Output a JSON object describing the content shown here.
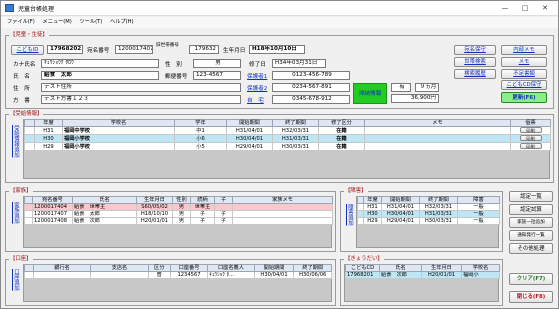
{
  "window": {
    "title": "児童台帳処理",
    "minimize": "—",
    "maximize": "□",
    "close": "✕"
  },
  "menu": [
    "ファイル(F)",
    "メニュー(M)",
    "ツール(T)",
    "ヘルプ(H)"
  ],
  "basic": {
    "section_title": "【児童・生徒】",
    "child_btn": "こどもID",
    "child_id": "17968202",
    "address_no_label": "宛名番号",
    "address_no": "1200017407",
    "guardian_label": "旧世帯番号",
    "guardian_no": "179632",
    "birth_label": "生年月日",
    "birth": "H18年10月10日",
    "kana_label": "カナ氏名",
    "kana": "ｷｭｳｼｮｳｸ ﾀﾛｳ",
    "sex_label": "性　別",
    "sex": "男",
    "grad_label": "修了日",
    "grad": "H34年03月31日",
    "name_label": "氏　名",
    "name": "給食　太郎",
    "zip_label": "郵便番号",
    "zip": "123-4567",
    "guardian1_label": "保護者1",
    "guardian1": "0123-456-789",
    "addr_label": "住　所",
    "addr": "テスト住所",
    "guardian2_label": "保護者2",
    "guardian2": "0234-567-891",
    "school_label": "方　書",
    "school": "テスト方書１２３",
    "home_label": "自　宅",
    "home": "0345-678-912",
    "tag_text": "滞納情報",
    "tag_val": "有",
    "tag_months": "９ヵ月",
    "tag_amount": "36,900円"
  },
  "side_buttons": {
    "col1": [
      "宛名保守",
      "世帯検索",
      "検索履歴"
    ],
    "col2": [
      "内部メモ",
      "メモ",
      "不足書類",
      "こどもCD保守"
    ],
    "update": "更新(F6)"
  },
  "school_section": {
    "title": "【受給情報】",
    "vtab": "受給情報追加",
    "headers": [
      "年度",
      "学校名",
      "学年",
      "開始期間",
      "終了期間",
      "修了区分",
      "メモ",
      "個票"
    ],
    "rows": [
      [
        "H31",
        "福岡中学校",
        "中1",
        "H31/04/01",
        "H32/03/31",
        "在籍",
        "",
        "印刷"
      ],
      [
        "H30",
        "福岡小学校",
        "小6",
        "H30/04/01",
        "H31/03/31",
        "在籍",
        "",
        "印刷"
      ],
      [
        "H29",
        "福岡小学校",
        "小5",
        "H29/04/01",
        "H30/03/31",
        "在籍",
        "",
        "印刷"
      ]
    ]
  },
  "family_section": {
    "title": "【家族】",
    "vtab": "家族追加",
    "headers": [
      "宛名番号",
      "氏名",
      "生年月日",
      "性別",
      "続柄",
      "子",
      "家族メモ"
    ],
    "rows": [
      [
        "1200017404",
        "給食　世帯主",
        "S60/05/02",
        "男",
        "世帯主",
        "",
        ""
      ],
      [
        "1200017407",
        "給食　太郎",
        "H18/10/10",
        "男",
        "子",
        "子",
        ""
      ],
      [
        "1200017408",
        "給食　次郎",
        "H20/01/01",
        "男",
        "子",
        "子",
        ""
      ]
    ]
  },
  "disability_section": {
    "title": "【障害】",
    "vtab": "障害追加",
    "headers": [
      "年度",
      "開始期間",
      "終了期間",
      "障害"
    ],
    "rows": [
      [
        "H31",
        "H31/04/01",
        "H32/03/31",
        "一般"
      ],
      [
        "H30",
        "H30/04/01",
        "H31/03/31",
        "一般"
      ],
      [
        "H29",
        "H29/04/01",
        "H30/03/31",
        "一般"
      ]
    ]
  },
  "bank_section": {
    "title": "【口座】",
    "vtab": "口座追加",
    "headers": [
      "銀行名",
      "支店名",
      "区分",
      "口座番号",
      "口座名義人",
      "開始期間",
      "終了期間"
    ],
    "rows": [
      [
        "",
        "",
        "普",
        "1234567",
        "ｷｭｳｼｮｸ ﾀ...",
        "H30/04/01",
        "H30/06/06"
      ]
    ]
  },
  "sibling_section": {
    "title": "【きょうだい】",
    "headers": [
      "こどもCD",
      "氏名",
      "生年月日",
      "学校名"
    ],
    "rows": [
      [
        "17968201",
        "給食　次郎",
        "H20/01/01",
        "福岡小"
      ]
    ]
  },
  "right_buttons": [
    "認定一覧",
    "認定試算",
    "家族一括追加",
    "通知発行一覧",
    "その他処理"
  ],
  "clear_btn": "クリア(F7)",
  "close_btn": "閉じる(F8)",
  "colors": {
    "accent_red": "#a01010",
    "link_blue": "#1030c0",
    "highlight": "#bfe6f5",
    "pink": "#f9c8cc",
    "green_tag": "#22cc22",
    "update_green": "#88ee88"
  }
}
